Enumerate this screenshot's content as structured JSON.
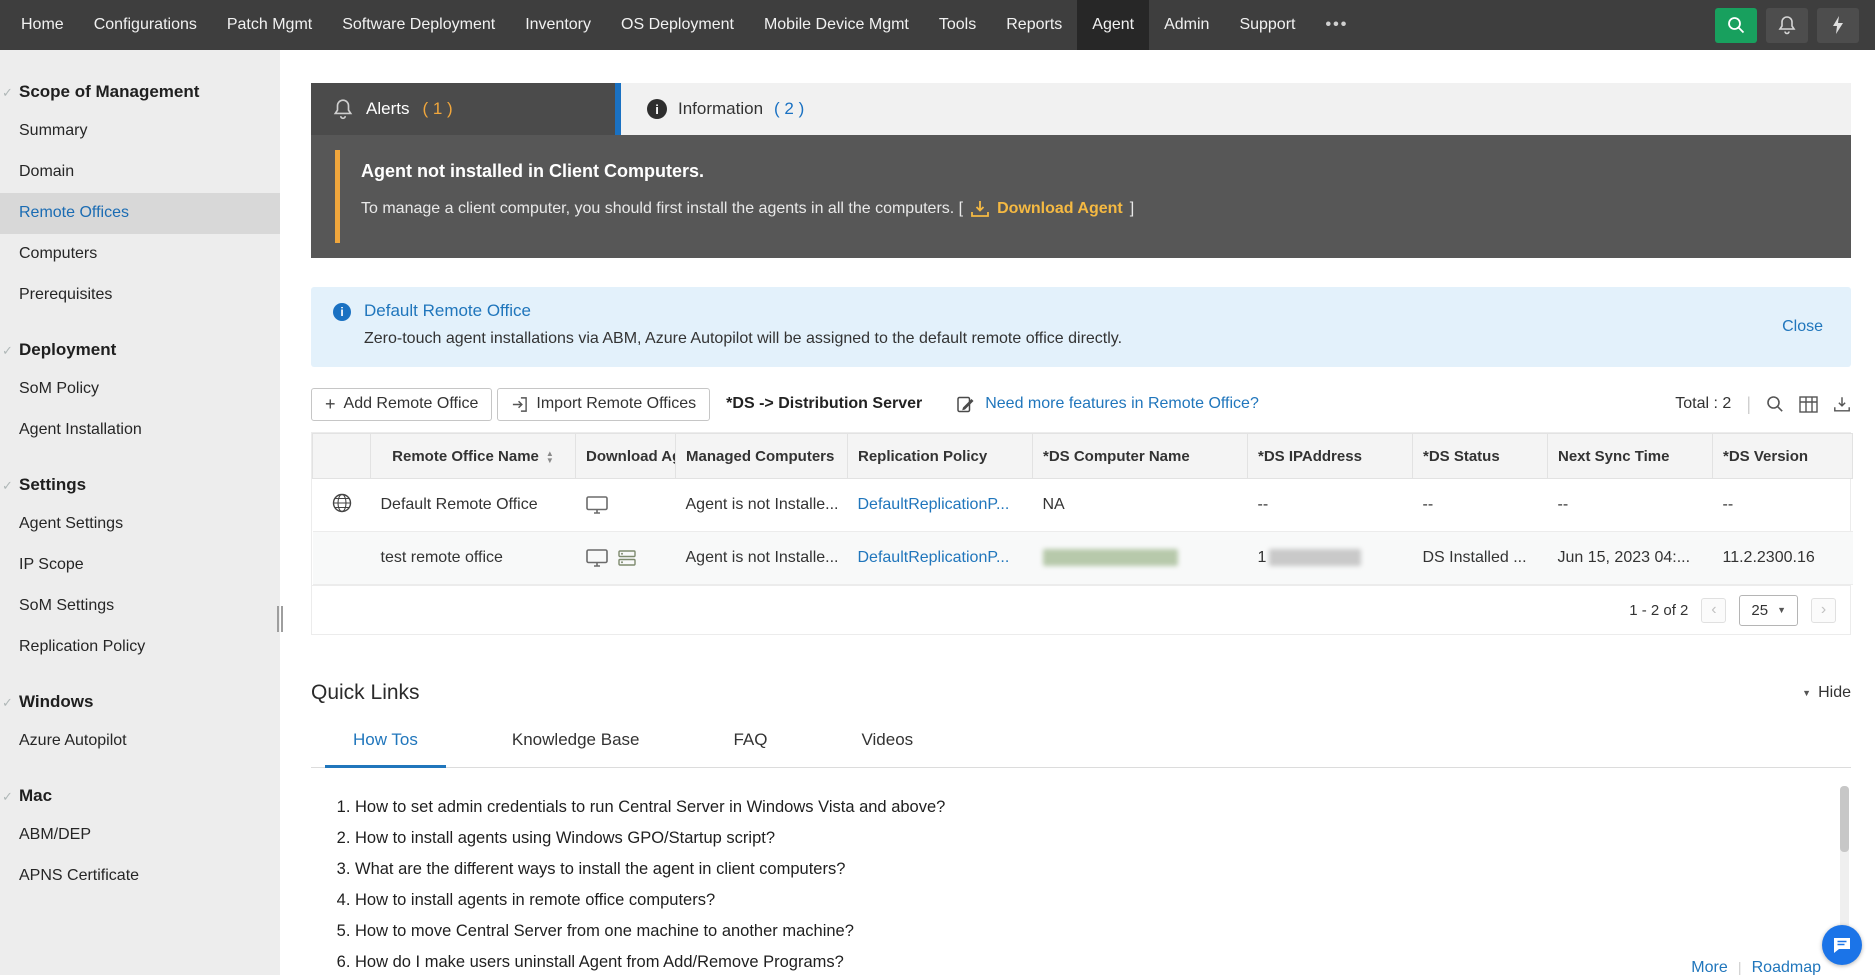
{
  "topnav": {
    "items": [
      {
        "label": "Home"
      },
      {
        "label": "Configurations"
      },
      {
        "label": "Patch Mgmt"
      },
      {
        "label": "Software Deployment"
      },
      {
        "label": "Inventory"
      },
      {
        "label": "OS Deployment"
      },
      {
        "label": "Mobile Device Mgmt"
      },
      {
        "label": "Tools"
      },
      {
        "label": "Reports"
      },
      {
        "label": "Agent"
      },
      {
        "label": "Admin"
      },
      {
        "label": "Support"
      },
      {
        "label": "•••"
      }
    ],
    "active": "Agent"
  },
  "sidebar": {
    "sections": [
      {
        "title": "Scope of Management",
        "items": [
          "Summary",
          "Domain",
          "Remote Offices",
          "Computers",
          "Prerequisites"
        ]
      },
      {
        "title": "Deployment",
        "items": [
          "SoM Policy",
          "Agent Installation"
        ]
      },
      {
        "title": "Settings",
        "items": [
          "Agent Settings",
          "IP Scope",
          "SoM Settings",
          "Replication Policy"
        ]
      },
      {
        "title": "Windows",
        "items": [
          "Azure Autopilot"
        ]
      },
      {
        "title": "Mac",
        "items": [
          "ABM/DEP",
          "APNS Certificate"
        ]
      }
    ],
    "selected": "Remote Offices"
  },
  "alert_panel": {
    "alerts_tab": {
      "label": "Alerts",
      "count": "( 1 )"
    },
    "info_tab": {
      "label": "Information",
      "count": "( 2 )"
    },
    "title": "Agent not installed in Client Computers.",
    "message_prefix": "To manage a client computer, you should first install the agents in all the computers. [",
    "download_link": "Download Agent",
    "message_suffix": "]"
  },
  "info_banner": {
    "title": "Default Remote Office",
    "message": "Zero-touch agent installations via ABM, Azure Autopilot will be assigned to the default remote office directly.",
    "close_label": "Close"
  },
  "toolbar": {
    "add_button": "Add Remote Office",
    "import_button": "Import Remote Offices",
    "ds_legend": "*DS -> Distribution Server",
    "feature_link": "Need more features in Remote Office?",
    "total_label": "Total : 2"
  },
  "table": {
    "headers": [
      "Remote Office Name",
      "Download Agent",
      "Managed Computers",
      "Replication Policy",
      "*DS Computer Name",
      "*DS IPAddress",
      "*DS Status",
      "Next Sync Time",
      "*DS Version"
    ],
    "rows": [
      {
        "name": "Default Remote Office",
        "managed_computers": "Agent is not Installe...",
        "replication_policy": "DefaultReplicationP...",
        "ds_computer_name": "NA",
        "ds_ip": "--",
        "ds_status": "--",
        "next_sync": "--",
        "ds_version": "--"
      },
      {
        "name": "test remote office",
        "managed_computers": "Agent is not Installe...",
        "replication_policy": "DefaultReplicationP...",
        "ds_computer_name": "",
        "ds_ip_prefix": "1",
        "ds_status": "DS Installed ...",
        "next_sync": "Jun 15, 2023 04:...",
        "ds_version": "11.2.2300.16"
      }
    ],
    "pagination": {
      "range": "1 - 2 of 2",
      "page_size": "25"
    }
  },
  "quick_links": {
    "title": "Quick Links",
    "hide_label": "Hide",
    "tabs": [
      "How Tos",
      "Knowledge Base",
      "FAQ",
      "Videos"
    ],
    "active_tab": "How Tos",
    "items": [
      "How to set admin credentials to run Central Server in Windows Vista and above?",
      "How to install agents using Windows GPO/Startup script?",
      "What are the different ways to install the agent in client computers?",
      "How to install agents in remote office computers?",
      "How to move Central Server from one machine to another machine?",
      "How do I make users uninstall Agent from Add/Remove Programs?"
    ],
    "footer_links": [
      "More",
      "Roadmap"
    ]
  }
}
